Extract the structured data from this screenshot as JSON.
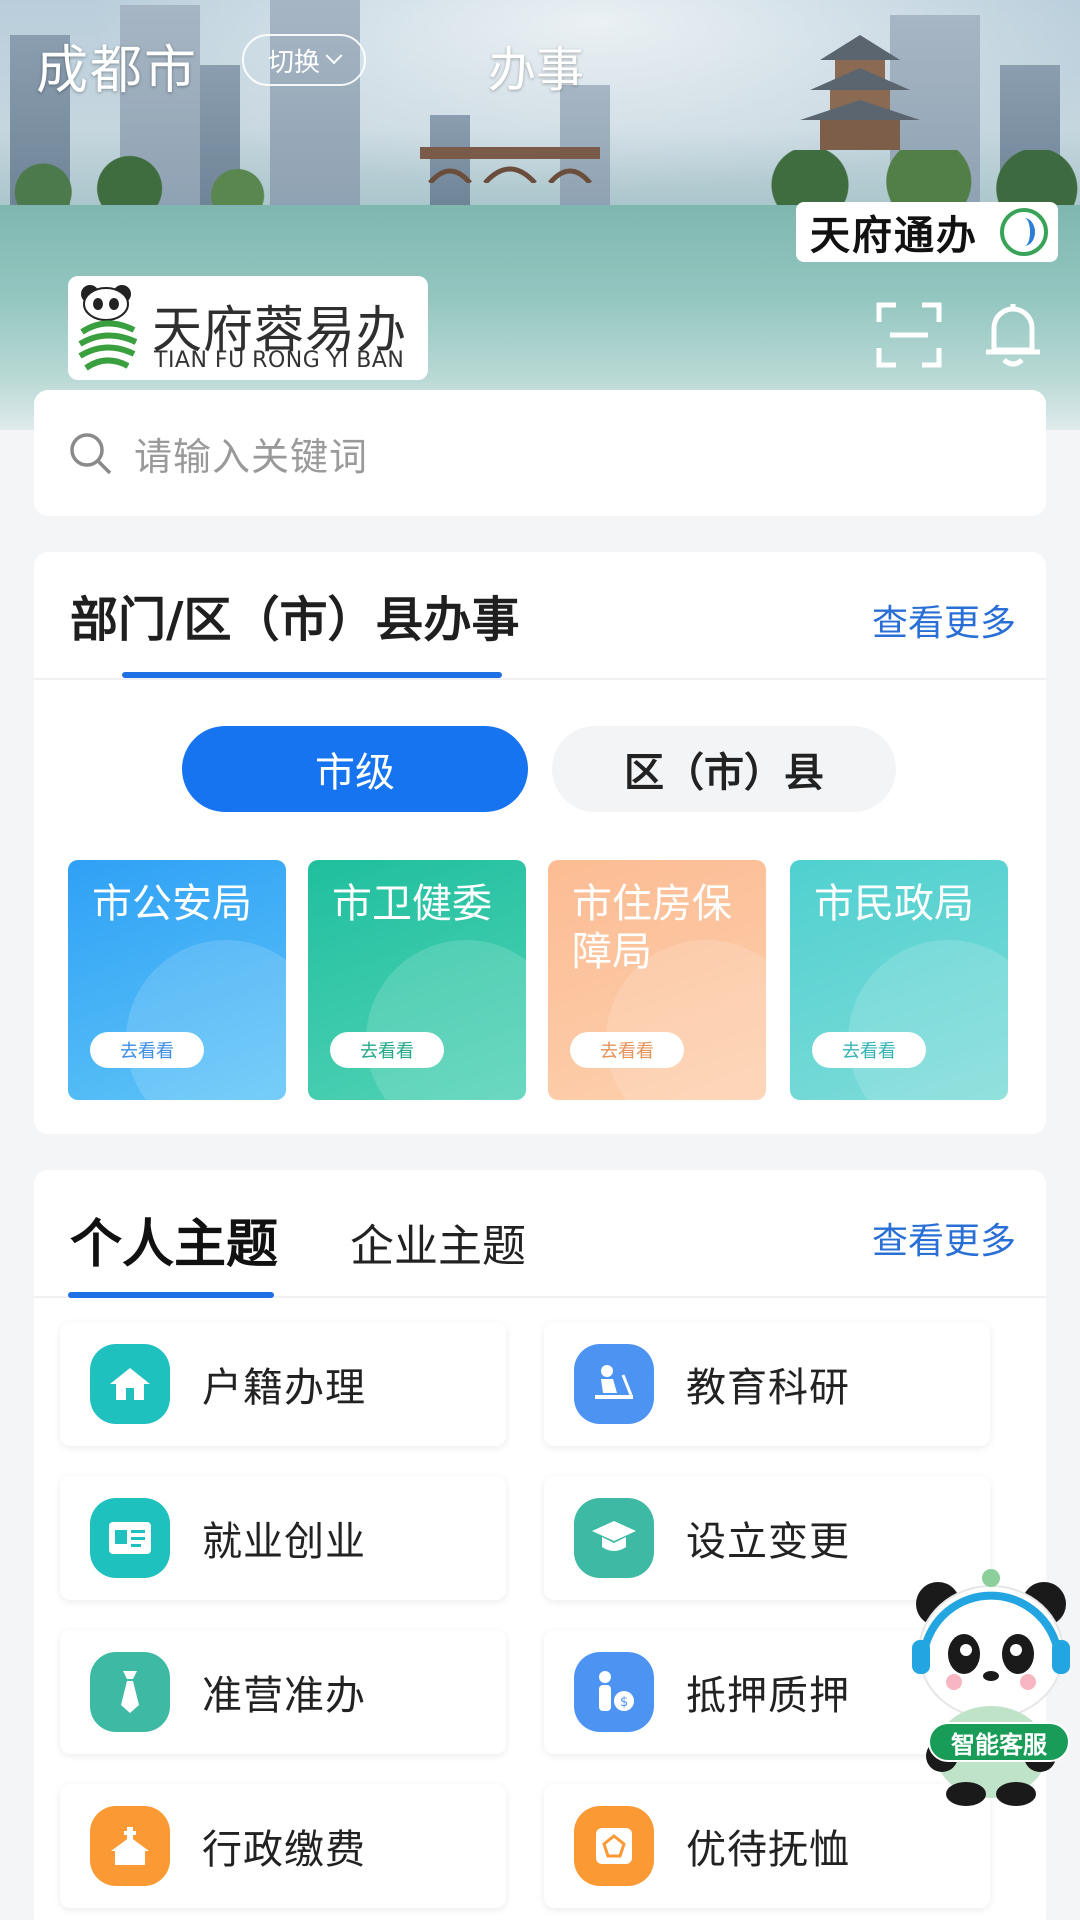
{
  "header": {
    "city": "成都市",
    "switch_label": "切换",
    "title": "办事",
    "badge_text": "天府通办",
    "logo_cn": "天府蓉易办",
    "logo_en": "TIAN FU RONG YI BAN"
  },
  "search": {
    "placeholder": "请输入关键词"
  },
  "departments": {
    "title": "部门/区（市）县办事",
    "more": "查看更多",
    "segments": [
      "市级",
      "区（市）县"
    ],
    "active_segment": "市级",
    "tiles": [
      {
        "name": "市公安局",
        "action": "去看看"
      },
      {
        "name": "市卫健委",
        "action": "去看看"
      },
      {
        "name": "市住房保障局",
        "action": "去看看"
      },
      {
        "name": "市民政局",
        "action": "去看看"
      }
    ]
  },
  "themes": {
    "tabs": [
      "个人主题",
      "企业主题"
    ],
    "active_tab": "个人主题",
    "more": "查看更多",
    "items": [
      {
        "label": "户籍办理",
        "icon": "house-icon"
      },
      {
        "label": "教育科研",
        "icon": "study-desk-icon"
      },
      {
        "label": "就业创业",
        "icon": "id-card-icon"
      },
      {
        "label": "设立变更",
        "icon": "graduation-cap-icon"
      },
      {
        "label": "准营准办",
        "icon": "tie-icon"
      },
      {
        "label": "抵押质押",
        "icon": "person-money-icon"
      },
      {
        "label": "行政缴费",
        "icon": "building-icon"
      },
      {
        "label": "优待抚恤",
        "icon": "badge-icon"
      }
    ]
  },
  "assistant": {
    "label": "智能客服"
  },
  "colors": {
    "accent_blue": "#1674f0",
    "link_blue": "#2a6fd6",
    "mascot_green": "#1a9c59"
  }
}
